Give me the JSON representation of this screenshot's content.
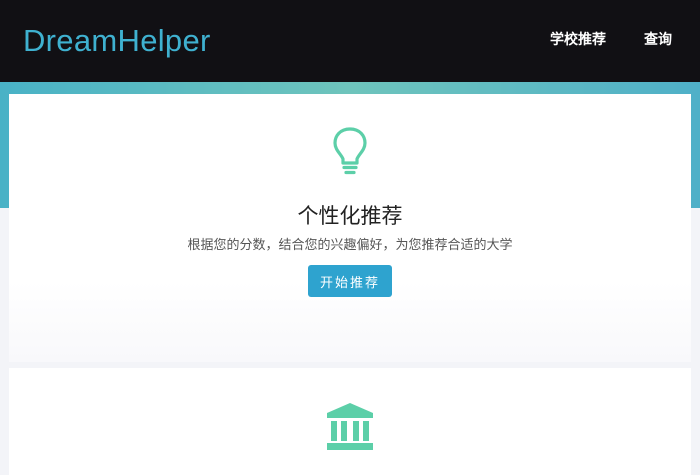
{
  "navbar": {
    "brand": "DreamHelper",
    "links": [
      {
        "label": "学校推荐"
      },
      {
        "label": "查询"
      }
    ]
  },
  "feature": {
    "icon": "lightbulb-icon",
    "title": "个性化推荐",
    "description": "根据您的分数，结合您的兴趣偏好，为您推荐合适的大学",
    "button_label": "开始推荐"
  },
  "section2": {
    "icon": "university-building-icon"
  },
  "colors": {
    "navbar_bg": "#111014",
    "brand": "#3fb1d0",
    "accent_teal": "#5ccfa8",
    "button": "#2ea3cf"
  }
}
